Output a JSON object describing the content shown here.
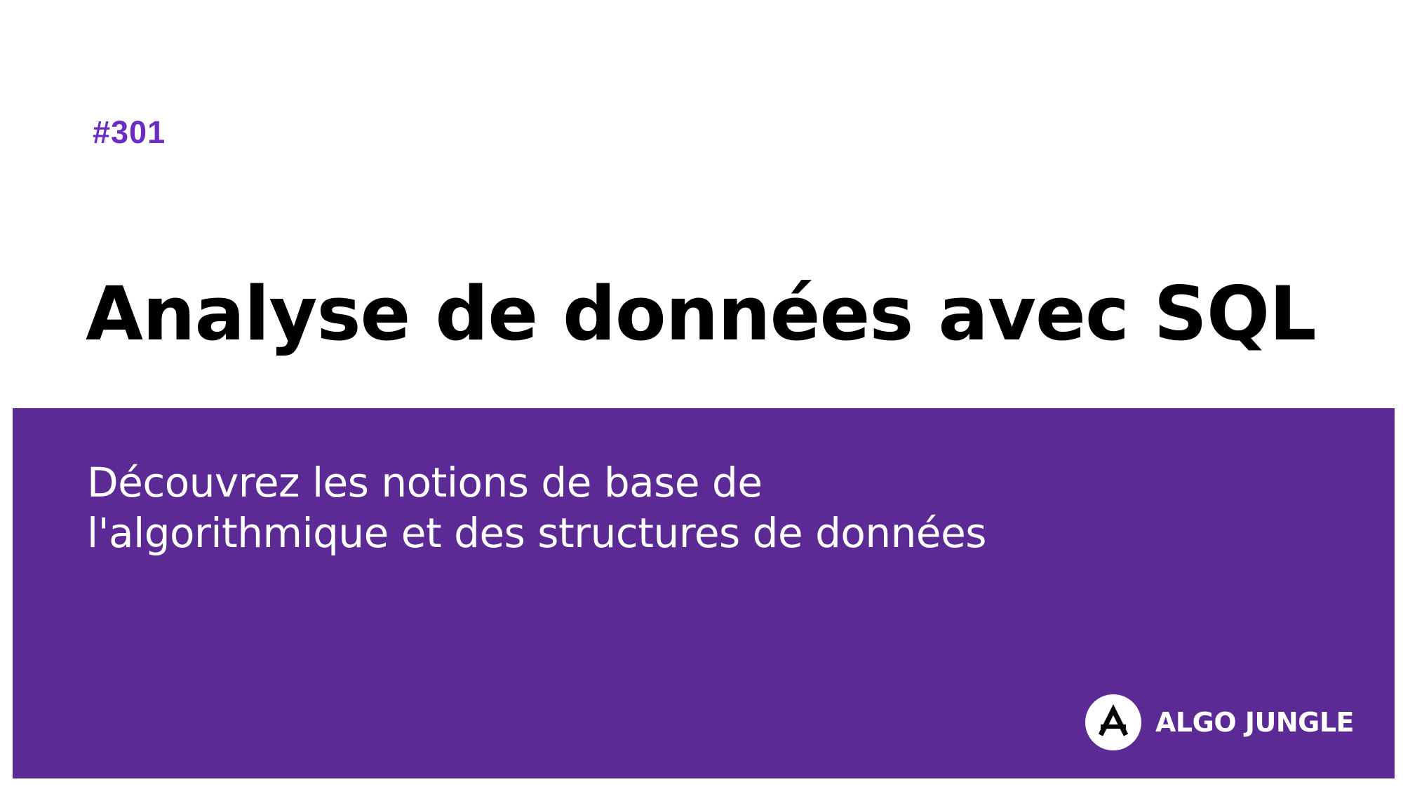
{
  "episode": "#301",
  "title": "Analyse de données avec SQL",
  "subtitle": {
    "line1": "Découvrez les notions de base de",
    "line2": "l'algorithmique et des structures de données"
  },
  "brand": {
    "name": "ALGO JUNGLE",
    "icon": "algo-jungle-logo-icon"
  },
  "colors": {
    "accent": "#6a2cc4",
    "band": "#5b2a94",
    "title": "#000000",
    "background": "#ffffff"
  }
}
